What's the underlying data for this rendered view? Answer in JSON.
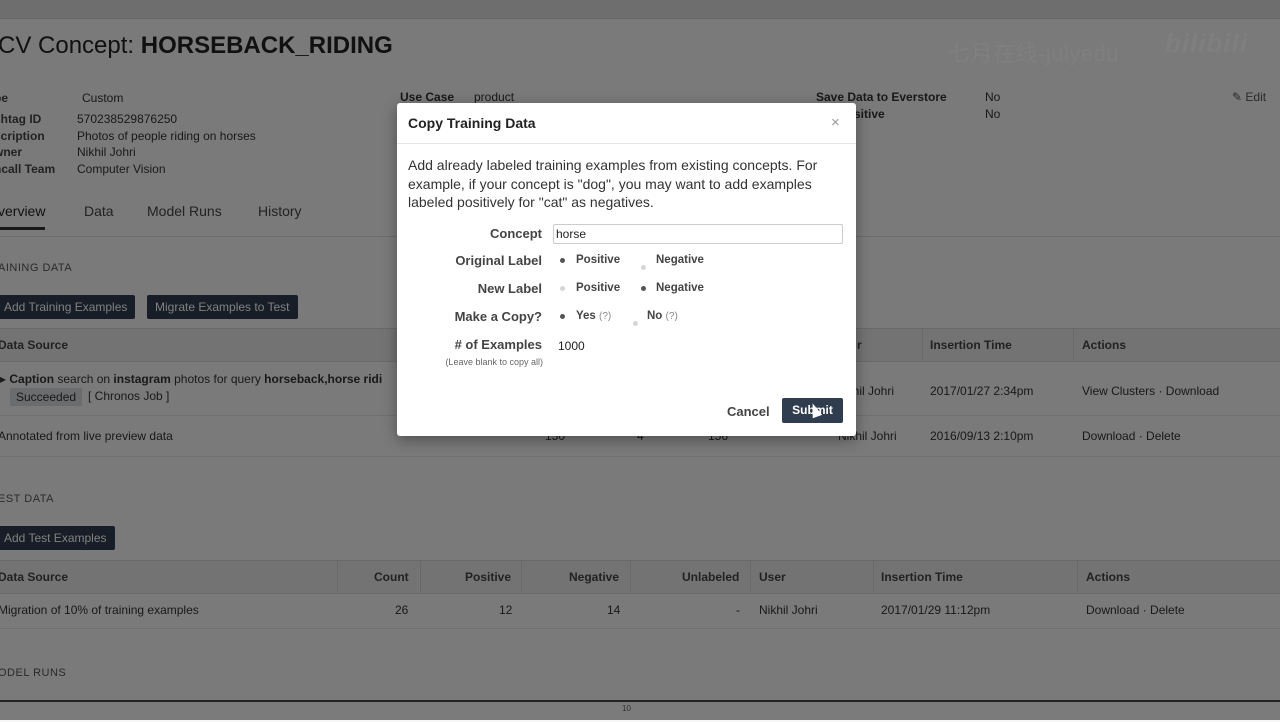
{
  "page": {
    "title_prefix": "CV Concept: ",
    "title_name": "HORSEBACK_RIDING",
    "watermark": "七月在线-julyedu",
    "watermark_logo": "bilibili",
    "meta": [
      {
        "key": "pe",
        "value": "Custom"
      },
      {
        "key": "shtag ID",
        "value": "570238529876250"
      },
      {
        "key": "scription",
        "value": "Photos of people riding on horses"
      },
      {
        "key": "wner",
        "value": "Nikhil Johri"
      },
      {
        "key": "ncall Team",
        "value": "Computer Vision"
      }
    ],
    "use_case_label": "Use Case",
    "use_case_value": "product",
    "save_label": "Save Data to Everstore",
    "save_value": "No",
    "sensitive_label": "ensitive",
    "sensitive_value": "No",
    "edit_label": "Edit",
    "tabs": [
      "verview",
      "Data",
      "Model Runs",
      "History"
    ],
    "training_section": "aining data",
    "btn_add_training": "Add Training Examples",
    "btn_migrate": "Migrate Examples to Test",
    "training_headers": {
      "data_source": "Data Source",
      "user": "r",
      "insertion_time": "Insertion Time",
      "actions": "Actions"
    },
    "training_rows": [
      {
        "source_prefix": "Caption",
        "source_text": " search on ",
        "source_platform": "instagram",
        "source_text2": " photos for query ",
        "source_query": "horseback,horse ridi",
        "status": "Succeeded",
        "job": "[ Chronos Job ]",
        "user": "ikhil Johri",
        "time": "2017/01/27 2:34pm",
        "actions": "View Clusters · Download"
      },
      {
        "source": "Annotated from live preview data",
        "n1": "150",
        "n2": "4",
        "n3": "156",
        "user": "Nikhil Johri",
        "time": "2016/09/13 2:10pm",
        "actions": "Download · Delete"
      }
    ],
    "test_section": "est data",
    "btn_add_test": "Add Test Examples",
    "test_headers": {
      "data_source": "Data Source",
      "count": "Count",
      "positive": "Positive",
      "negative": "Negative",
      "unlabeled": "Unlabeled",
      "user": "User",
      "insertion_time": "Insertion Time",
      "actions": "Actions"
    },
    "test_row": {
      "source": "Migration of 10% of training examples",
      "count": "26",
      "positive": "12",
      "negative": "14",
      "unlabeled": "-",
      "user": "Nikhil Johri",
      "time": "2017/01/29 11:12pm",
      "actions": "Download · Delete"
    },
    "model_runs_section": "odel runs",
    "footer_mark": "10"
  },
  "modal": {
    "title": "Copy Training Data",
    "close": "×",
    "description": "Add already labeled training examples from existing concepts. For example, if your concept is \"dog\", you may want to add examples labeled positively for \"cat\" as negatives.",
    "concept_label": "Concept",
    "concept_value": "horse",
    "original_label": "Original Label",
    "new_label": "New Label",
    "copy_label": "Make a Copy?",
    "examples_label": "# of Examples",
    "examples_hint": "(Leave blank to copy all)",
    "examples_value": "1000",
    "opt_positive": "Positive",
    "opt_negative": "Negative",
    "opt_yes": "Yes",
    "opt_no": "No",
    "help": "(?)",
    "cancel": "Cancel",
    "submit": "Submit",
    "original_selected": "Positive",
    "new_selected": "Negative",
    "copy_selected": "Yes"
  }
}
